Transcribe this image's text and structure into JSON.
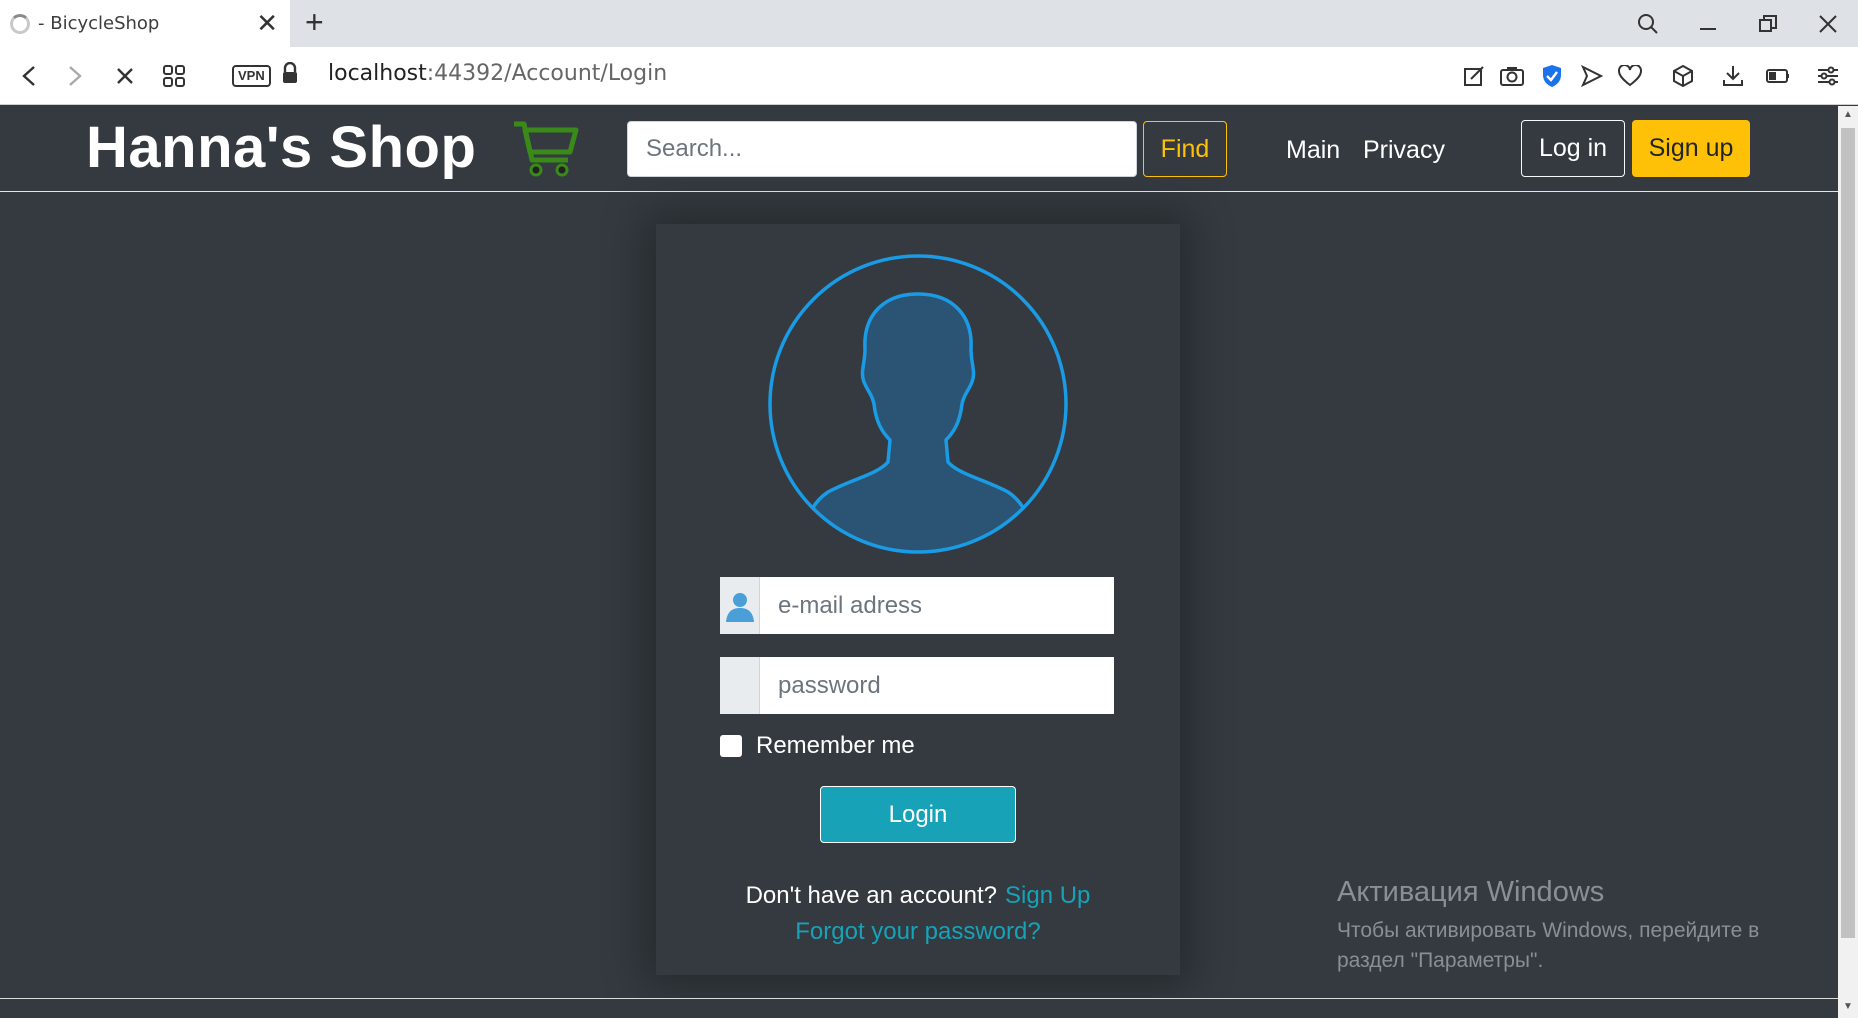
{
  "browser": {
    "tab_title": "- BicycleShop",
    "url_host": "localhost",
    "url_path": ":44392/Account/Login",
    "vpn_label": "VPN"
  },
  "navbar": {
    "brand": "Hanna's Shop",
    "search_placeholder": "Search...",
    "find_label": "Find",
    "links": [
      "Main",
      "Privacy"
    ],
    "login_label": "Log in",
    "signup_label": "Sign up",
    "colors": {
      "warning": "#ffc107",
      "dark": "#343a40",
      "cart": "#3a8a1a"
    }
  },
  "login": {
    "email_placeholder": "e-mail adress",
    "password_placeholder": "password",
    "remember_label": "Remember me",
    "submit_label": "Login",
    "no_account_text": "Don't have an account?",
    "signup_link": "Sign Up",
    "forgot_link": "Forgot your password?",
    "colors": {
      "accent": "#17a2b8",
      "avatar_ring": "#1a9be6",
      "avatar_fill": "#2b5474"
    }
  },
  "watermark": {
    "title": "Активация Windows",
    "text": "Чтобы активировать Windows, перейдите в раздел \"Параметры\"."
  }
}
